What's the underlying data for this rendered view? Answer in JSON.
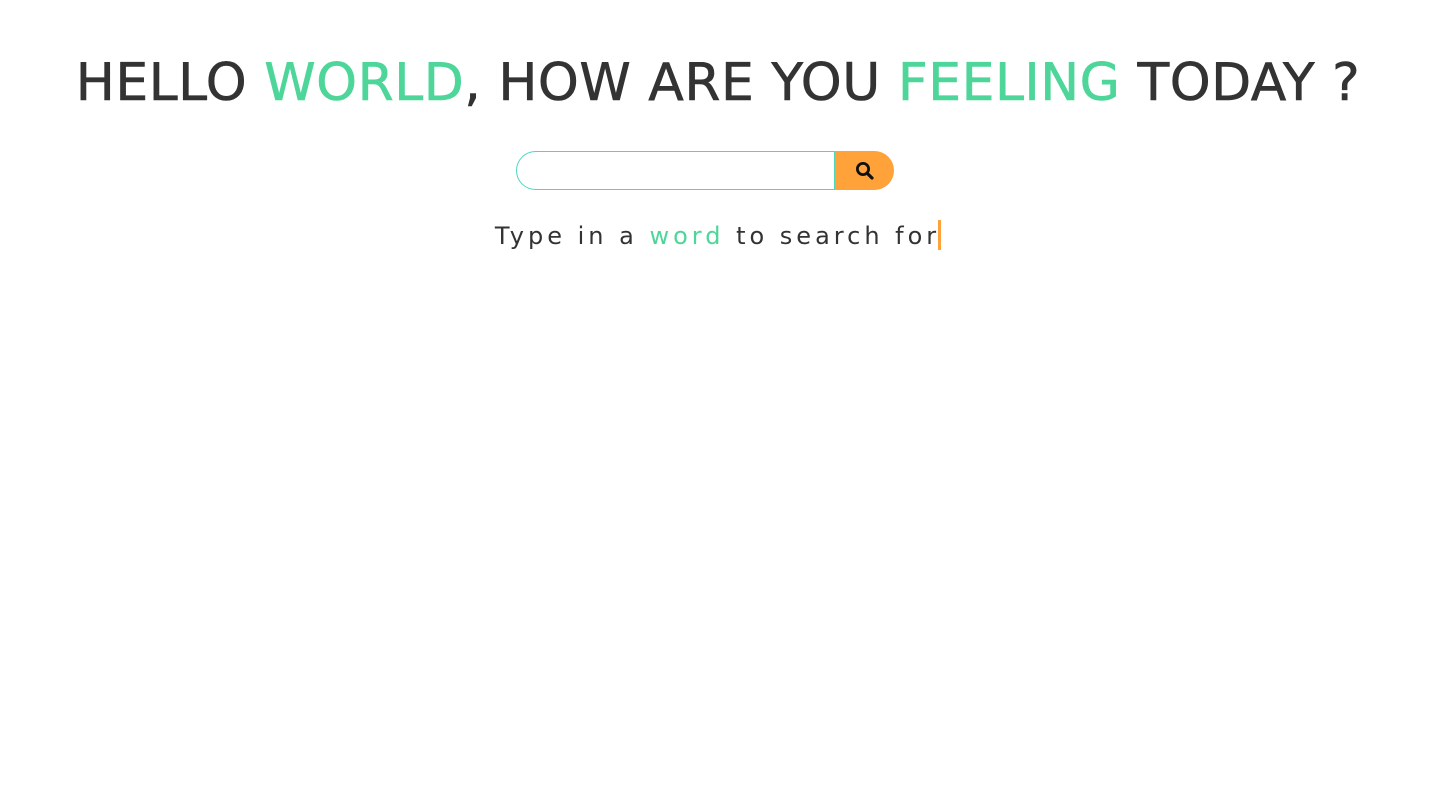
{
  "headline": {
    "part1": "HELLO ",
    "accent1": "WORLD",
    "part2": ", HOW ARE YOU ",
    "accent2": "FEELING",
    "part3": " TODAY ?"
  },
  "search": {
    "value": "",
    "placeholder": "",
    "button_icon": "search-icon"
  },
  "tagline": {
    "part1": "Type in a ",
    "accent": "word",
    "part2": " to search for"
  },
  "colors": {
    "text": "#333333",
    "accent_green": "#4ed69a",
    "input_border": "#4ed6bf",
    "button_orange": "#ffa23a"
  }
}
